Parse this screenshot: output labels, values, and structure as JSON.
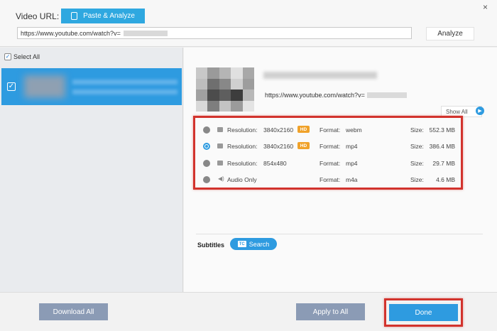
{
  "header": {
    "video_url_label": "Video URL:",
    "paste_button": "Paste & Analyze",
    "url_value": "https://www.youtube.com/watch?v=",
    "analyze_button": "Analyze",
    "close_glyph": "×"
  },
  "left_panel": {
    "select_all_label": "Select All",
    "check_glyph": "✓",
    "items_selected": [
      true
    ]
  },
  "video": {
    "link": "https://www.youtube.com/watch?v=",
    "thumb_colors": [
      "#c8c8c8",
      "#9a9a9a",
      "#b5b5b5",
      "#e0e0e0",
      "#a8a8a8",
      "#bdbdbd",
      "#6f6f6f",
      "#888888",
      "#cfcfcf",
      "#9d9d9d",
      "#a0a0a0",
      "#4c4c4c",
      "#5e5e5e",
      "#3d3d3d",
      "#b8b8b8",
      "#d8d8d8",
      "#7e7e7e",
      "#c3c3c3",
      "#9b9b9b",
      "#e4e4e4"
    ]
  },
  "show_all": {
    "label": "Show All",
    "icon": "play-circle-icon",
    "glyph": "▶"
  },
  "formats": {
    "resolution_label": "Resolution:",
    "format_label": "Format:",
    "size_label": "Size:",
    "hd_badge": "HD",
    "audio_glyph": "◀)",
    "rows": [
      {
        "type": "video",
        "resolution": "3840x2160",
        "hd": true,
        "format": "webm",
        "size": "552.3 MB",
        "selected": false
      },
      {
        "type": "video",
        "resolution": "3840x2160",
        "hd": true,
        "format": "mp4",
        "size": "386.4 MB",
        "selected": true
      },
      {
        "type": "video",
        "resolution": "854x480",
        "hd": false,
        "format": "mp4",
        "size": "29.7 MB",
        "selected": false
      },
      {
        "type": "audio",
        "label": "Audio Only",
        "format": "m4a",
        "size": "4.6 MB",
        "selected": false
      }
    ]
  },
  "subtitles": {
    "label": "Subtitles",
    "search_button": "Search",
    "icon_glyph": "TC"
  },
  "footer": {
    "download_all": "Download All",
    "apply_to_all": "Apply to All",
    "done": "Done"
  },
  "colors": {
    "accent": "#2e9be0",
    "highlight": "#d2332d",
    "hd_badge": "#f0a22a",
    "gray_button": "#8b9bb5"
  }
}
